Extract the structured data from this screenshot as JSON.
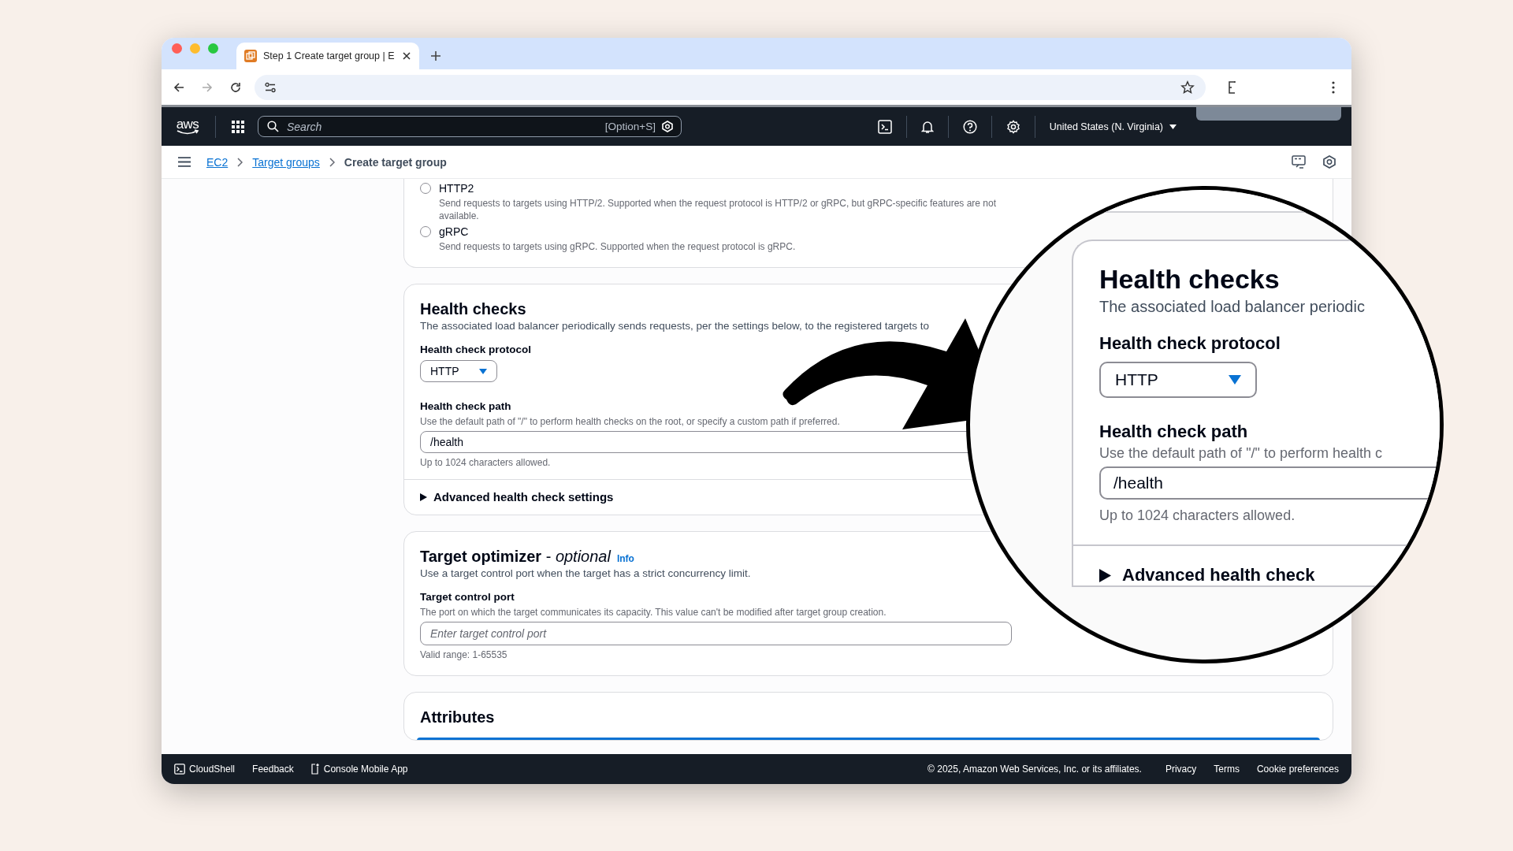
{
  "browser": {
    "tab": {
      "title": "Step 1 Create target group | E",
      "selected": true
    },
    "forward_disabled": true
  },
  "aws_nav": {
    "logo": "aws",
    "search": {
      "placeholder": "Search",
      "shortcut": "[Option+S]"
    },
    "region": "United States (N. Virginia)"
  },
  "breadcrumbs": [
    {
      "label": "EC2",
      "kind": "link"
    },
    {
      "label": "Target groups",
      "kind": "link"
    },
    {
      "label": "Create target group",
      "kind": "current"
    }
  ],
  "protocol_options": [
    {
      "label": "HTTP2",
      "description": "Send requests to targets using HTTP/2. Supported when the request protocol is HTTP/2 or gRPC, but gRPC-specific features are not available.",
      "selected": false
    },
    {
      "label": "gRPC",
      "description": "Send requests to targets using gRPC. Supported when the request protocol is gRPC.",
      "selected": false
    }
  ],
  "health_checks": {
    "title": "Health checks",
    "description": "The associated load balancer periodically sends requests, per the settings below, to the registered targets to",
    "protocol": {
      "label": "Health check protocol",
      "value": "HTTP"
    },
    "path": {
      "label": "Health check path",
      "description": "Use the default path of \"/\" to perform health checks on the root, or specify a custom path if preferred.",
      "value": "/health",
      "hint": "Up to 1024 characters allowed."
    },
    "advanced": {
      "label": "Advanced health check settings",
      "expanded": false
    }
  },
  "target_optimizer": {
    "title": "**Target optimizer** - *optional*",
    "info": "Info",
    "description": "Use a target control port when the target has a strict concurrency limit.",
    "port": {
      "label": "Target control port",
      "description": "The port on which the target communicates its capacity. This value can't be modified after target group creation.",
      "placeholder": "Enter target control port",
      "hint": "Valid range: 1-65535"
    }
  },
  "attributes": {
    "title": "Attributes"
  },
  "magnifier": {
    "title": "Health checks",
    "description": "The associated load balancer periodic",
    "protocol": {
      "label": "Health check protocol",
      "value": "HTTP"
    },
    "path": {
      "label": "Health check path",
      "description": "Use the default path of \"/\" to perform health c",
      "value": "/health",
      "hint": "Up to 1024 characters allowed."
    },
    "advanced": {
      "label": "Advanced health check",
      "expanded": false
    }
  },
  "footer": {
    "left": [
      "CloudShell",
      "Feedback",
      "Console Mobile App"
    ],
    "copyright": "© 2025, Amazon Web Services, Inc. or its affiliates.",
    "links": [
      "Privacy",
      "Terms",
      "Cookie preferences"
    ]
  }
}
